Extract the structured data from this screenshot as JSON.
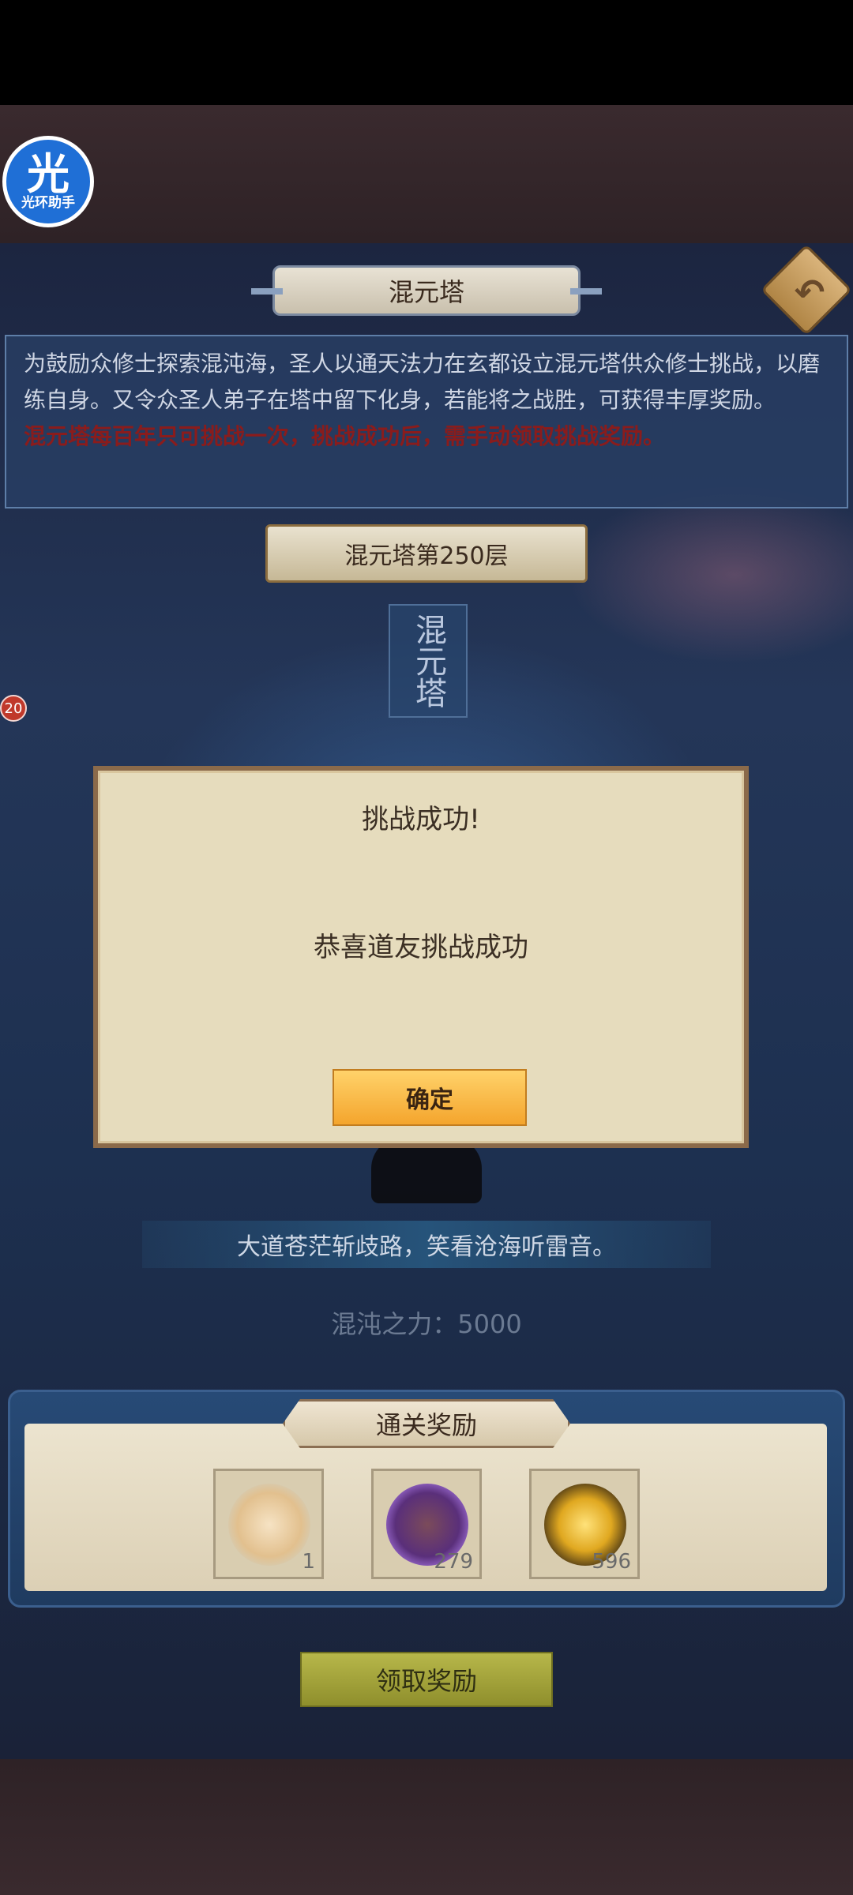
{
  "app_badge": {
    "glyph": "光",
    "label": "光环助手"
  },
  "header": {
    "title": "混元塔",
    "back_icon": "back-arrow-icon"
  },
  "description": {
    "text": "为鼓励众修士探索混沌海，圣人以通天法力在玄都设立混元塔供众修士挑战，以磨练自身。又令众圣人弟子在塔中留下化身，若能将之战胜，可获得丰厚奖励。",
    "warning": "混元塔每百年只可挑战一次，挑战成功后，需手动领取挑战奖励。"
  },
  "floor": {
    "label": "混元塔第250层"
  },
  "tower_sign": "混元塔",
  "side_badge": "20",
  "dialog": {
    "title": "挑战成功!",
    "message": "恭喜道友挑战成功",
    "confirm": "确定"
  },
  "slogan": "大道苍茫斩歧路，笑看沧海听雷音。",
  "power": "混沌之力：5000",
  "rewards": {
    "title": "通关奖励",
    "items": [
      {
        "icon": "talisman-icon",
        "count": "1"
      },
      {
        "icon": "purple-orb-icon",
        "count": "279"
      },
      {
        "icon": "golden-flame-icon",
        "count": "596"
      }
    ]
  },
  "claim_button": "领取奖励",
  "colors": {
    "accent": "#f4a52d",
    "warning": "#8a1c1c",
    "panel": "#274a76"
  }
}
